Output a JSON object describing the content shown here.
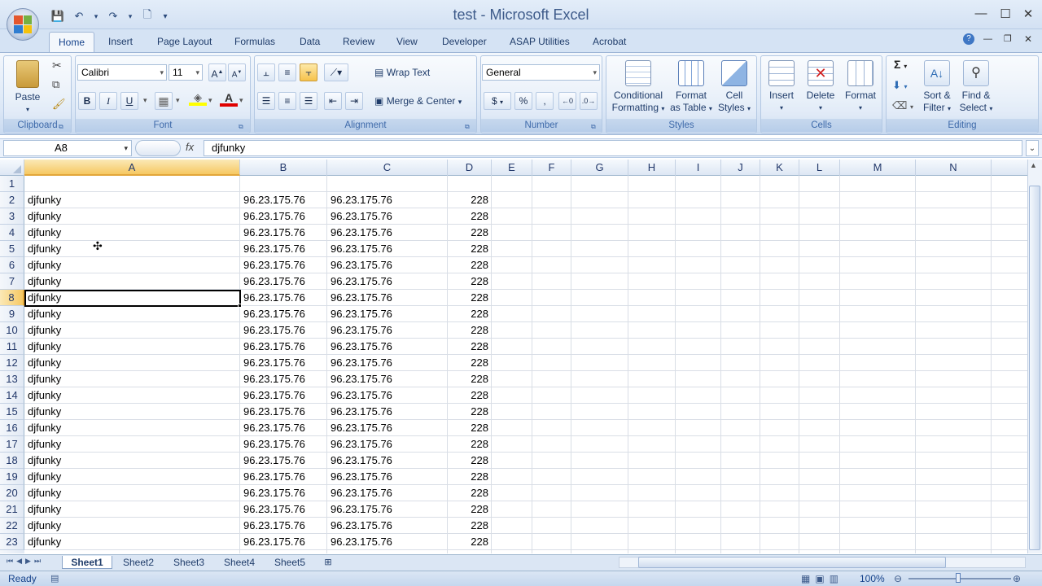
{
  "window": {
    "title": "test - Microsoft Excel"
  },
  "tabs": [
    "Home",
    "Insert",
    "Page Layout",
    "Formulas",
    "Data",
    "Review",
    "View",
    "Developer",
    "ASAP Utilities",
    "Acrobat"
  ],
  "ribbon": {
    "clipboard": {
      "label": "Clipboard",
      "paste": "Paste"
    },
    "font": {
      "label": "Font",
      "name": "Calibri",
      "size": "11",
      "bold": "B",
      "italic": "I",
      "underline": "U"
    },
    "alignment": {
      "label": "Alignment",
      "wrap": "Wrap Text",
      "merge": "Merge & Center"
    },
    "number": {
      "label": "Number",
      "format": "General",
      "currency": "$",
      "percent": "%",
      "comma": ","
    },
    "styles": {
      "label": "Styles",
      "cond1": "Conditional",
      "cond2": "Formatting",
      "table1": "Format",
      "table2": "as Table",
      "cell1": "Cell",
      "cell2": "Styles"
    },
    "cells": {
      "label": "Cells",
      "insert": "Insert",
      "delete": "Delete",
      "format": "Format"
    },
    "editing": {
      "label": "Editing",
      "sigma": "Σ",
      "sort1": "Sort &",
      "sort2": "Filter",
      "find1": "Find &",
      "find2": "Select"
    }
  },
  "formula_bar": {
    "name_box": "A8",
    "fx": "fx",
    "content": "djfunky"
  },
  "columns": [
    "A",
    "B",
    "C",
    "D",
    "E",
    "F",
    "G",
    "H",
    "I",
    "J",
    "K",
    "L",
    "M",
    "N"
  ],
  "rows": [
    {
      "n": "1",
      "a": "",
      "b": "",
      "c": "",
      "d": ""
    },
    {
      "n": "2",
      "a": "djfunky",
      "b": "96.23.175.76",
      "c": "96.23.175.76",
      "d": "228"
    },
    {
      "n": "3",
      "a": "djfunky",
      "b": "96.23.175.76",
      "c": "96.23.175.76",
      "d": "228"
    },
    {
      "n": "4",
      "a": "djfunky",
      "b": "96.23.175.76",
      "c": "96.23.175.76",
      "d": "228"
    },
    {
      "n": "5",
      "a": "djfunky",
      "b": "96.23.175.76",
      "c": "96.23.175.76",
      "d": "228"
    },
    {
      "n": "6",
      "a": "djfunky",
      "b": "96.23.175.76",
      "c": "96.23.175.76",
      "d": "228"
    },
    {
      "n": "7",
      "a": "djfunky",
      "b": "96.23.175.76",
      "c": "96.23.175.76",
      "d": "228"
    },
    {
      "n": "8",
      "a": "djfunky",
      "b": "96.23.175.76",
      "c": "96.23.175.76",
      "d": "228"
    },
    {
      "n": "9",
      "a": "djfunky",
      "b": "96.23.175.76",
      "c": "96.23.175.76",
      "d": "228"
    },
    {
      "n": "10",
      "a": "djfunky",
      "b": "96.23.175.76",
      "c": "96.23.175.76",
      "d": "228"
    },
    {
      "n": "11",
      "a": "djfunky",
      "b": "96.23.175.76",
      "c": "96.23.175.76",
      "d": "228"
    },
    {
      "n": "12",
      "a": "djfunky",
      "b": "96.23.175.76",
      "c": "96.23.175.76",
      "d": "228"
    },
    {
      "n": "13",
      "a": "djfunky",
      "b": "96.23.175.76",
      "c": "96.23.175.76",
      "d": "228"
    },
    {
      "n": "14",
      "a": "djfunky",
      "b": "96.23.175.76",
      "c": "96.23.175.76",
      "d": "228"
    },
    {
      "n": "15",
      "a": "djfunky",
      "b": "96.23.175.76",
      "c": "96.23.175.76",
      "d": "228"
    },
    {
      "n": "16",
      "a": "djfunky",
      "b": "96.23.175.76",
      "c": "96.23.175.76",
      "d": "228"
    },
    {
      "n": "17",
      "a": "djfunky",
      "b": "96.23.175.76",
      "c": "96.23.175.76",
      "d": "228"
    },
    {
      "n": "18",
      "a": "djfunky",
      "b": "96.23.175.76",
      "c": "96.23.175.76",
      "d": "228"
    },
    {
      "n": "19",
      "a": "djfunky",
      "b": "96.23.175.76",
      "c": "96.23.175.76",
      "d": "228"
    },
    {
      "n": "20",
      "a": "djfunky",
      "b": "96.23.175.76",
      "c": "96.23.175.76",
      "d": "228"
    },
    {
      "n": "21",
      "a": "djfunky",
      "b": "96.23.175.76",
      "c": "96.23.175.76",
      "d": "228"
    },
    {
      "n": "22",
      "a": "djfunky",
      "b": "96.23.175.76",
      "c": "96.23.175.76",
      "d": "228"
    },
    {
      "n": "23",
      "a": "djfunky",
      "b": "96.23.175.76",
      "c": "96.23.175.76",
      "d": "228"
    }
  ],
  "sheets": [
    "Sheet1",
    "Sheet2",
    "Sheet3",
    "Sheet4",
    "Sheet5"
  ],
  "status": {
    "ready": "Ready",
    "zoom": "100%"
  },
  "colors": {
    "selected_col_header": "#f8d88a",
    "ribbon_bg": "#dbe7f6",
    "text": "#15428b"
  }
}
